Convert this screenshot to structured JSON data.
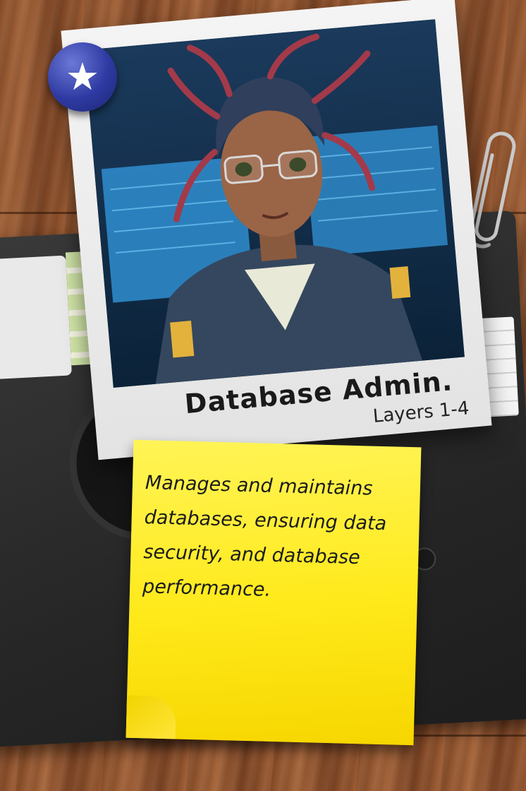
{
  "card": {
    "title": "Database Admin.",
    "subtitle": "Layers 1-4",
    "description": "Manages and maintains databases, ensuring data security, and database performance."
  },
  "pin": {
    "icon": "star-icon",
    "color": "#2e3aa2"
  },
  "colors": {
    "sticky_note": "#ffe91a",
    "polaroid": "#eeeeee",
    "floppy": "#2a2a2a",
    "wood": "#8a4f2a"
  }
}
